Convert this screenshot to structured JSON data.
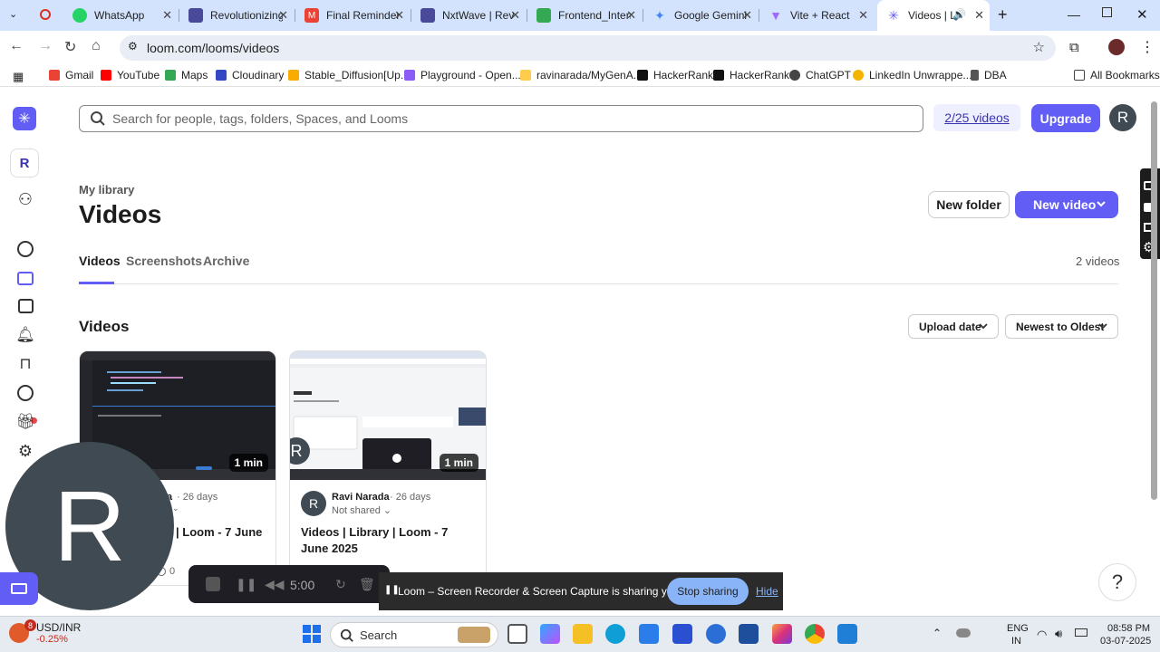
{
  "browser": {
    "tabs": [
      {
        "title": "WhatsApp",
        "color": "#25d366"
      },
      {
        "title": "Revolutionizing",
        "color": "#4a4a9a"
      },
      {
        "title": "Final Reminder",
        "color": "#ea4335"
      },
      {
        "title": "NxtWave | Revo",
        "color": "#4a4a9a"
      },
      {
        "title": "Frontend_Intern",
        "color": "#34a853"
      },
      {
        "title": "Google Gemini",
        "color": "#4285f4"
      },
      {
        "title": "Vite + React",
        "color": "#9f6bff"
      },
      {
        "title": "Videos | Lib",
        "color": "#625df5"
      }
    ],
    "url": "loom.com/looms/videos",
    "bookmarks": [
      "Gmail",
      "YouTube",
      "Maps",
      "Cloudinary",
      "Stable_Diffusion[Up...",
      "Playground - Open...",
      "ravinarada/MyGenA...",
      "HackerRank",
      "HackerRank",
      "ChatGPT",
      "LinkedIn Unwrappe...",
      "DBA"
    ],
    "all_bookmarks": "All Bookmarks"
  },
  "header": {
    "search_placeholder": "Search for people, tags, folders, Spaces, and Looms",
    "quota": "2/25 videos",
    "upgrade": "Upgrade",
    "avatar": "R"
  },
  "sidebar": {
    "avatar": "R"
  },
  "library": {
    "subtitle": "My library",
    "title": "Videos",
    "new_folder": "New folder",
    "new_video": "New video",
    "tabs": [
      "Videos",
      "Screenshots",
      "Archive"
    ],
    "count": "2 videos",
    "section_title": "Videos",
    "sort_field": "Upload date",
    "sort_order": "Newest to Oldest"
  },
  "videos": [
    {
      "owner": "a",
      "days": "· 26 days",
      "duration": "1 min",
      "title": "| Loom - 7 June",
      "views": "0"
    },
    {
      "owner": "Ravi Narada",
      "days": "· 26 days",
      "duration": "1 min",
      "share": "Not shared",
      "title": "Videos | Library | Loom - 7 June 2025",
      "avatar": "R"
    }
  ],
  "overlay": {
    "camera_letter": "R",
    "timer": "5:00",
    "share_msg": "Loom – Screen Recorder & Screen Capture is sharing your screen.",
    "stop": "Stop sharing",
    "hide": "Hide",
    "help": "?"
  },
  "taskbar": {
    "ticker": "USD/INR",
    "change": "-0.25%",
    "badge": "8",
    "search": "Search",
    "lang1": "ENG",
    "lang2": "IN",
    "time": "08:58 PM",
    "date": "03-07-2025"
  }
}
